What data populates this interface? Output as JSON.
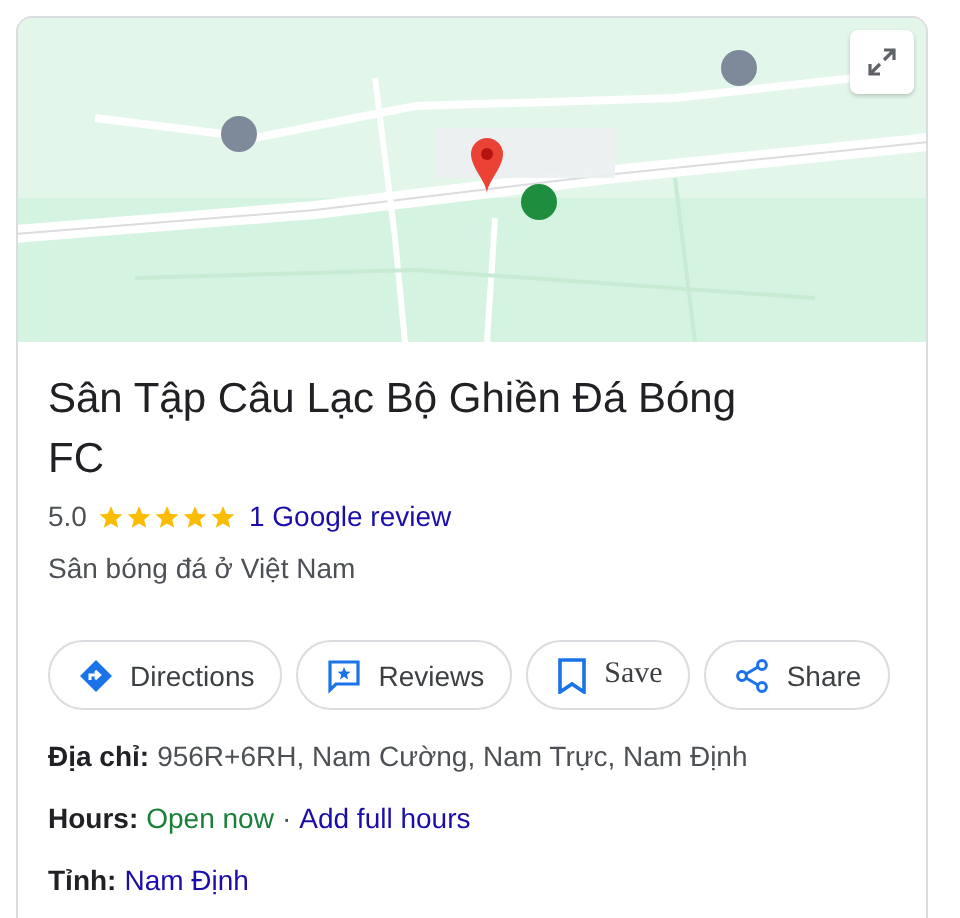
{
  "title": "Sân Tập Câu Lạc Bộ Ghiền Đá Bóng FC",
  "rating": {
    "score": "5.0",
    "stars": 5,
    "reviews_link": "1 Google review"
  },
  "category": "Sân bóng đá ở Việt Nam",
  "actions": [
    {
      "kind": "directions",
      "label": "Directions"
    },
    {
      "kind": "reviews",
      "label": "Reviews"
    },
    {
      "kind": "save",
      "label": "Save"
    },
    {
      "kind": "share",
      "label": "Share"
    }
  ],
  "facts": [
    {
      "label": "Địa chỉ:",
      "value": "956R+6RH, Nam Cường, Nam Trực, Nam Định"
    },
    {
      "label": "Hours:",
      "status": "Open now",
      "separator": "·",
      "link": "Add full hours"
    },
    {
      "label": "Tỉnh:",
      "link": "Nam Định"
    }
  ]
}
